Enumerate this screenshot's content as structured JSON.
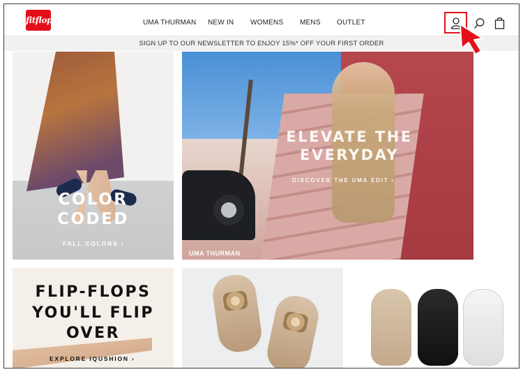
{
  "header": {
    "logo_text": "fitflop",
    "nav": [
      "UMA THURMAN",
      "NEW IN",
      "WOMENS",
      "MENS",
      "OUTLET"
    ],
    "icons": [
      "account-icon",
      "search-icon",
      "bag-icon"
    ]
  },
  "banner": {
    "text": "SIGN UP TO OUR NEWSLETTER TO ENJOY 15%* OFF YOUR FIRST ORDER"
  },
  "tiles": {
    "color": {
      "title_1": "COLOR",
      "title_2": "CODED",
      "link": "FALL COLORS ›"
    },
    "elevate": {
      "title_1": "ELEVATE THE",
      "title_2": "EVERYDAY",
      "link": "DISCOVER THE UMA EDIT ›",
      "caption": "UMA THURMAN"
    },
    "flipflops": {
      "title_1": "FLIP-FLOPS",
      "title_2": "YOU'LL FLIP",
      "title_3": "OVER",
      "link": "EXPLORE IQUSHION ›"
    }
  },
  "colors": {
    "brand_red": "#e3101a",
    "banner_bg": "#f1f1f1",
    "highlight": "#e3101a"
  }
}
